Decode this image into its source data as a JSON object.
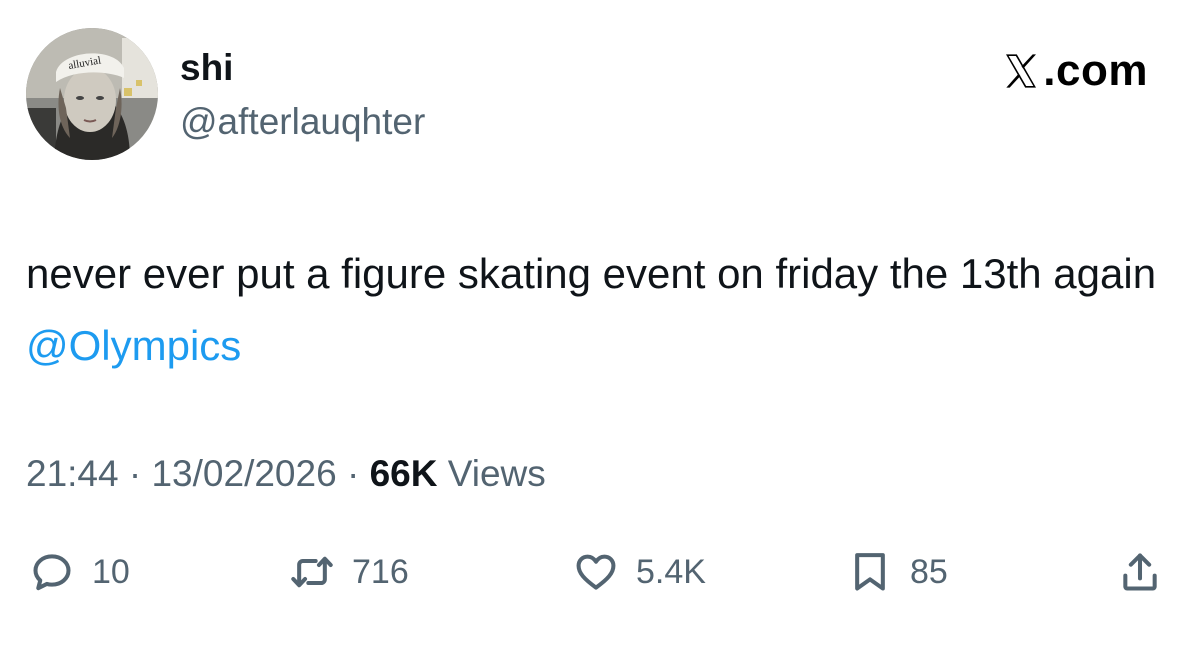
{
  "author": {
    "display_name": "shi",
    "handle": "@afterlauqhter",
    "avatar_icon": "profile-photo",
    "avatar_cap_text": "alluvial"
  },
  "brand": {
    "text": ".com",
    "icon": "x-logo-icon"
  },
  "tweet": {
    "text_before_mention": "never ever put a figure skating event on friday the 13th again ",
    "mention": "@Olympics"
  },
  "meta": {
    "time": "21:44",
    "separator_1": "·",
    "date": "13/02/2026",
    "separator_2": "·",
    "views_count": "66K",
    "views_label": "Views"
  },
  "actions": {
    "reply": {
      "icon": "reply-icon",
      "count": "10"
    },
    "retweet": {
      "icon": "retweet-icon",
      "count": "716"
    },
    "like": {
      "icon": "heart-icon",
      "count": "5.4K"
    },
    "bookmark": {
      "icon": "bookmark-icon",
      "count": "85"
    },
    "share": {
      "icon": "share-icon"
    }
  },
  "colors": {
    "text_primary": "#0f1419",
    "text_secondary": "#536471",
    "mention": "#1d9bf0",
    "background": "#ffffff"
  }
}
